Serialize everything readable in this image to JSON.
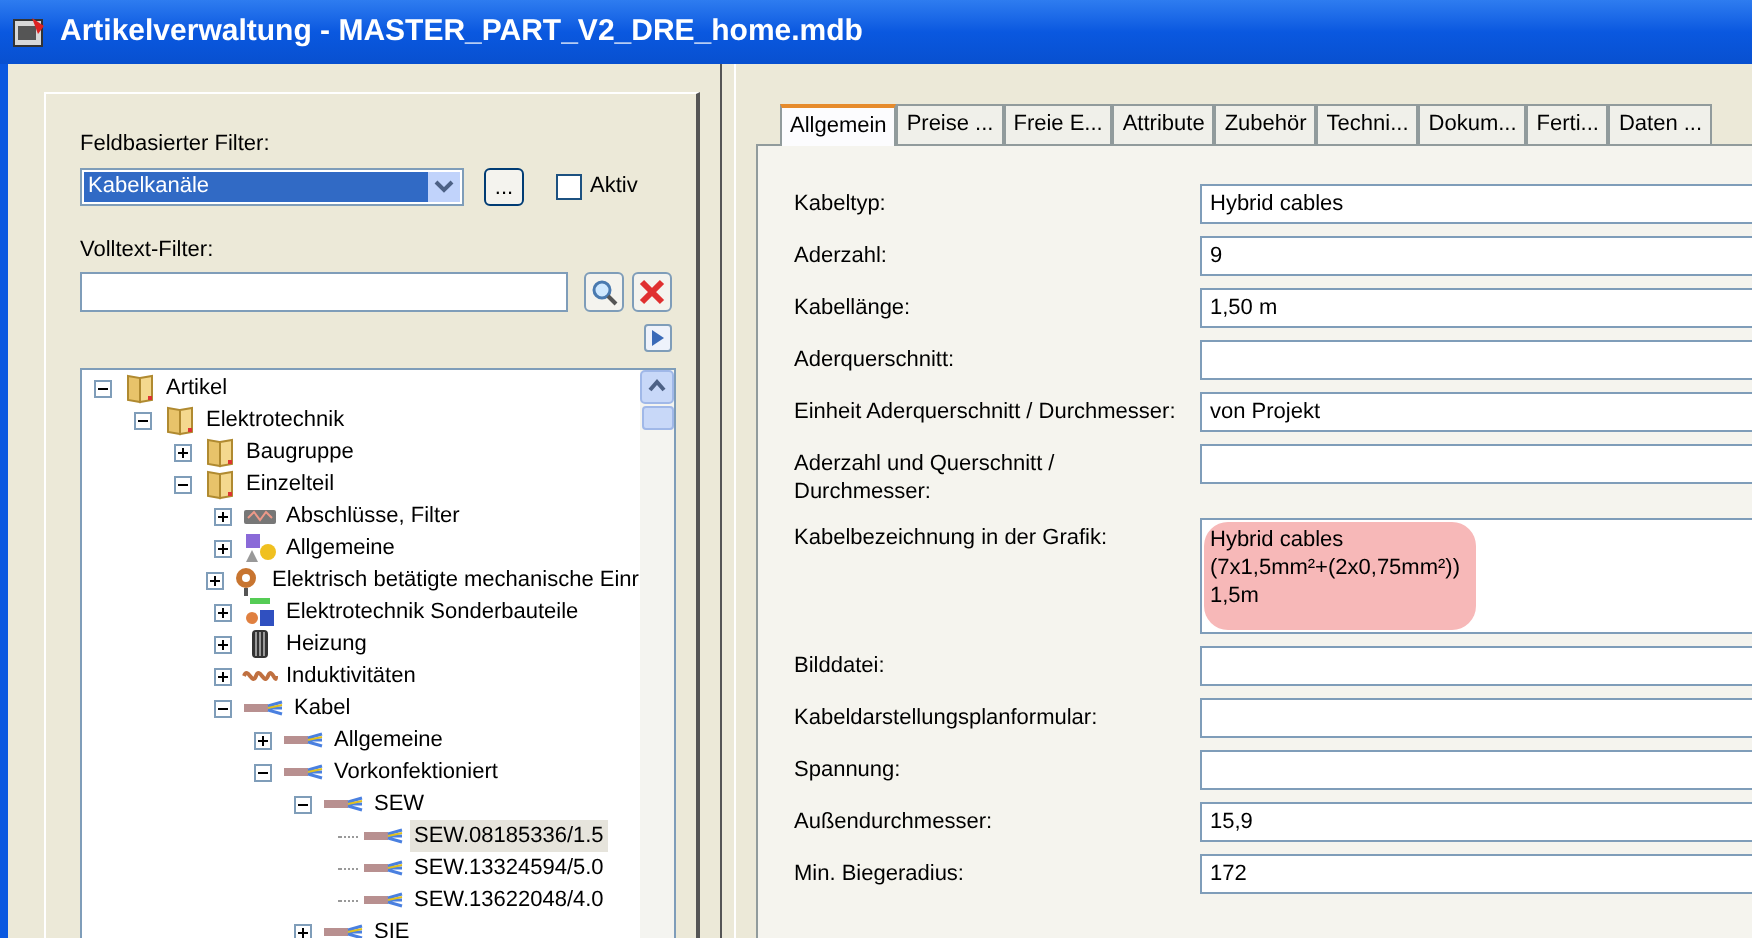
{
  "window": {
    "title": "Artikelverwaltung - MASTER_PART_V2_DRE_home.mdb"
  },
  "filter": {
    "field_label": "Feldbasierter Filter:",
    "field_value": "Kabelkanäle",
    "more_button": "...",
    "active_label": "Aktiv",
    "active_checked": false,
    "fulltext_label": "Volltext-Filter:"
  },
  "tree": [
    {
      "label": "Artikel",
      "kind": "folder",
      "expanded": true,
      "selected": false,
      "children": [
        {
          "label": "Elektrotechnik",
          "kind": "folder",
          "expanded": true,
          "selected": false,
          "children": [
            {
              "label": "Baugruppe",
              "kind": "folder",
              "expanded": false,
              "selected": false
            },
            {
              "label": "Einzelteil",
              "kind": "folder",
              "expanded": true,
              "selected": false,
              "children": [
                {
                  "label": "Abschlüsse, Filter",
                  "kind": "filter",
                  "expanded": false,
                  "selected": false
                },
                {
                  "label": "Allgemeine",
                  "kind": "shapes",
                  "expanded": false,
                  "selected": false
                },
                {
                  "label": "Elektrisch betätigte mechanische Einr",
                  "kind": "relay",
                  "expanded": false,
                  "selected": false
                },
                {
                  "label": "Elektrotechnik Sonderbauteile",
                  "kind": "plug",
                  "expanded": false,
                  "selected": false
                },
                {
                  "label": "Heizung",
                  "kind": "heater",
                  "expanded": false,
                  "selected": false
                },
                {
                  "label": "Induktivitäten",
                  "kind": "coil",
                  "expanded": false,
                  "selected": false
                },
                {
                  "label": "Kabel",
                  "kind": "cable",
                  "expanded": true,
                  "selected": false,
                  "children": [
                    {
                      "label": "Allgemeine",
                      "kind": "cable",
                      "expanded": false,
                      "selected": false
                    },
                    {
                      "label": "Vorkonfektioniert",
                      "kind": "cable",
                      "expanded": true,
                      "selected": false,
                      "children": [
                        {
                          "label": "SEW",
                          "kind": "cable",
                          "expanded": true,
                          "selected": false,
                          "children": [
                            {
                              "label": "SEW.08185336/1.5",
                              "kind": "cable",
                              "selected": true
                            },
                            {
                              "label": "SEW.13324594/5.0",
                              "kind": "cable",
                              "selected": false
                            },
                            {
                              "label": "SEW.13622048/4.0",
                              "kind": "cable",
                              "selected": false
                            }
                          ]
                        },
                        {
                          "label": "SIE",
                          "kind": "cable",
                          "expanded": false,
                          "selected": false
                        }
                      ]
                    }
                  ]
                }
              ]
            }
          ]
        }
      ]
    }
  ],
  "tabs": [
    {
      "label": "Allgemein",
      "selected": true
    },
    {
      "label": "Preise ...",
      "selected": false
    },
    {
      "label": "Freie E...",
      "selected": false
    },
    {
      "label": "Attribute",
      "selected": false
    },
    {
      "label": "Zubehör",
      "selected": false
    },
    {
      "label": "Techni...",
      "selected": false
    },
    {
      "label": "Dokum...",
      "selected": false
    },
    {
      "label": "Ferti...",
      "selected": false
    },
    {
      "label": "Daten ...",
      "selected": false
    }
  ],
  "fields": [
    {
      "label": "Kabeltyp:",
      "kind": "text",
      "value": "Hybrid cables",
      "highlighted": false
    },
    {
      "label": "Aderzahl:",
      "kind": "text",
      "value": "9",
      "highlighted": false
    },
    {
      "label": "Kabellänge:",
      "kind": "text",
      "value": "1,50 m",
      "highlighted": false
    },
    {
      "label": "Aderquerschnitt:",
      "kind": "text",
      "highlighted": false
    },
    {
      "label": "Einheit Aderquerschnitt / Durchmesser:",
      "kind": "text",
      "value": "von Projekt",
      "highlighted": false
    },
    {
      "label": "Aderzahl und Querschnitt /\nDurchmesser:",
      "kind": "text",
      "highlighted": false
    },
    {
      "label": "Kabelbezeichnung in der Grafik:",
      "kind": "multiline",
      "value": "Hybrid cables\n(7x1,5mm²+(2x0,75mm²))\n1,5m",
      "highlighted": true
    },
    {
      "label": "Bilddatei:",
      "kind": "text",
      "highlighted": false
    },
    {
      "label": "Kabeldarstellungsplanformular:",
      "kind": "text",
      "highlighted": false
    },
    {
      "label": "Spannung:",
      "kind": "text",
      "highlighted": false
    },
    {
      "label": "Außendurchmesser:",
      "kind": "text",
      "value": "15,9",
      "highlighted": false
    },
    {
      "label": "Min. Biegeradius:",
      "kind": "text",
      "value": "172",
      "highlighted": false
    }
  ]
}
